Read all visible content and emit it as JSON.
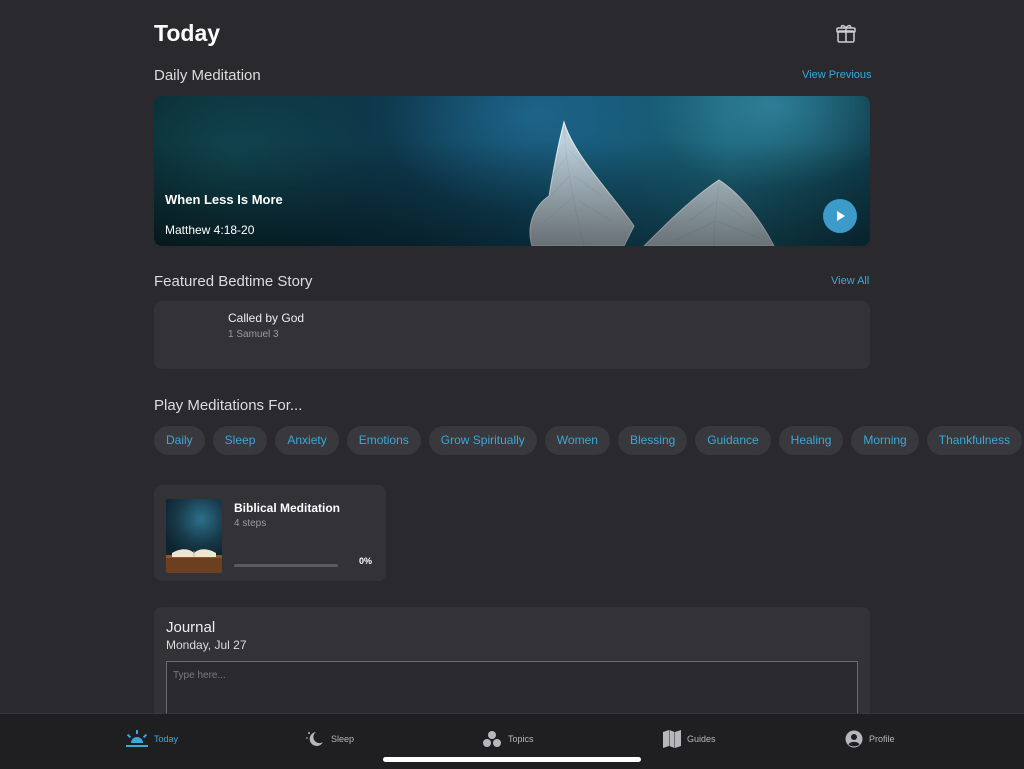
{
  "header": {
    "title": "Today",
    "gift_icon": "gift-icon"
  },
  "daily_meditation": {
    "section_title": "Daily Meditation",
    "view_link": "View Previous",
    "card": {
      "title": "When Less Is More",
      "reference": "Matthew 4:18-20",
      "play_icon": "play-icon"
    }
  },
  "bedtime_story": {
    "section_title": "Featured Bedtime Story",
    "view_link": "View All",
    "card": {
      "title": "Called by God",
      "reference": "1 Samuel 3"
    }
  },
  "play_for": {
    "section_title": "Play Meditations For...",
    "chips": [
      "Daily",
      "Sleep",
      "Anxiety",
      "Emotions",
      "Grow Spiritually",
      "Women",
      "Blessing",
      "Guidance",
      "Healing",
      "Morning",
      "Thankfulness"
    ]
  },
  "plan": {
    "title": "Biblical Meditation",
    "steps": "4 steps",
    "progress_label": "0%",
    "progress": 0
  },
  "journal": {
    "title": "Journal",
    "date": "Monday, Jul 27",
    "placeholder": "Type here..."
  },
  "tabbar": {
    "tabs": [
      {
        "label": "Today",
        "icon": "sunrise-icon"
      },
      {
        "label": "Sleep",
        "icon": "moon-icon"
      },
      {
        "label": "Topics",
        "icon": "topics-icon"
      },
      {
        "label": "Guides",
        "icon": "map-icon"
      },
      {
        "label": "Profile",
        "icon": "person-icon"
      }
    ]
  },
  "colors": {
    "accent": "#38a9d9",
    "background": "#2a2a2e",
    "card": "#323237",
    "play_button": "#3d9bc9"
  }
}
